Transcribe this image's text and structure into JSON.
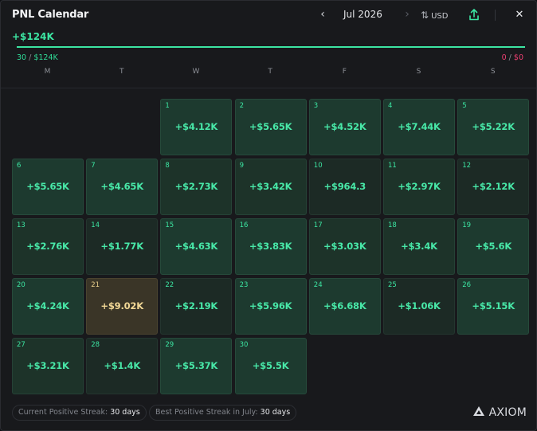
{
  "header": {
    "title": "PNL Calendar",
    "prev_icon": "chevron-left-icon",
    "month": "Jul 2026",
    "next_icon": "chevron-right-icon",
    "sort_icon": "sort-arrows-icon",
    "currency": "USD",
    "share_icon": "share-upload-icon",
    "close_icon": "close-icon"
  },
  "summary": {
    "total": "+$124K",
    "progress_positive_fraction": 1.0,
    "positive_count": "30",
    "positive_sum": "$124K",
    "negative_count": "0",
    "negative_sum": "$0",
    "separator": " / "
  },
  "weekdays": [
    "M",
    "T",
    "W",
    "T",
    "F",
    "S",
    "S"
  ],
  "days": [
    {
      "day": "1",
      "pnl": "+$4.12K"
    },
    {
      "day": "2",
      "pnl": "+$5.65K"
    },
    {
      "day": "3",
      "pnl": "+$4.52K"
    },
    {
      "day": "4",
      "pnl": "+$7.44K"
    },
    {
      "day": "5",
      "pnl": "+$5.22K"
    },
    {
      "day": "6",
      "pnl": "+$5.65K"
    },
    {
      "day": "7",
      "pnl": "+$4.65K"
    },
    {
      "day": "8",
      "pnl": "+$2.73K"
    },
    {
      "day": "9",
      "pnl": "+$3.42K"
    },
    {
      "day": "10",
      "pnl": "+$964.3"
    },
    {
      "day": "11",
      "pnl": "+$2.97K"
    },
    {
      "day": "12",
      "pnl": "+$2.12K"
    },
    {
      "day": "13",
      "pnl": "+$2.76K"
    },
    {
      "day": "14",
      "pnl": "+$1.77K"
    },
    {
      "day": "15",
      "pnl": "+$4.63K"
    },
    {
      "day": "16",
      "pnl": "+$3.83K"
    },
    {
      "day": "17",
      "pnl": "+$3.03K"
    },
    {
      "day": "18",
      "pnl": "+$3.4K"
    },
    {
      "day": "19",
      "pnl": "+$5.6K"
    },
    {
      "day": "20",
      "pnl": "+$4.24K"
    },
    {
      "day": "21",
      "pnl": "+$9.02K"
    },
    {
      "day": "22",
      "pnl": "+$2.19K"
    },
    {
      "day": "23",
      "pnl": "+$5.96K"
    },
    {
      "day": "24",
      "pnl": "+$6.68K"
    },
    {
      "day": "25",
      "pnl": "+$1.06K"
    },
    {
      "day": "26",
      "pnl": "+$5.15K"
    },
    {
      "day": "27",
      "pnl": "+$3.21K"
    },
    {
      "day": "28",
      "pnl": "+$1.4K"
    },
    {
      "day": "29",
      "pnl": "+$5.37K"
    },
    {
      "day": "30",
      "pnl": "+$5.5K"
    }
  ],
  "first_weekday_index": 2,
  "best_day": "21",
  "colors": {
    "positive": "#3ce5a2",
    "negative": "#ee3f72",
    "best_day": "#f2d896",
    "panel_bg": "#18191c"
  },
  "footer": {
    "current_streak_label": "Current Positive Streak:",
    "current_streak_value": "30 days",
    "best_streak_label": "Best Positive Streak in July:",
    "best_streak_value": "30 days",
    "brand": "AXIOM",
    "brand_icon": "axiom-logo-icon"
  }
}
